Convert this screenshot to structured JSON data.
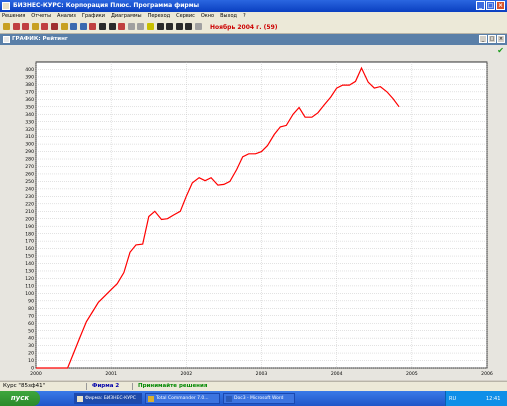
{
  "window": {
    "title": "БИЗНЕС-КУРС: Корпорация Плюс. Программа фирмы"
  },
  "menu": [
    "Решения",
    "Отчеты",
    "Анализ",
    "Графики",
    "Диаграммы",
    "Переход",
    "Сервис",
    "Окно",
    "Выход",
    "?"
  ],
  "toolbar": {
    "period": "Ноябрь 2004 г. (59)",
    "icon_colors": [
      "#c8a020",
      "#c04040",
      "#c04040",
      "#c8a020",
      "#c04040",
      "#a03030",
      "#c8a020",
      "#3a6ab0",
      "#3a6ab0",
      "#c04040",
      "#2a2a2a",
      "#2a2a2a",
      "#c04040",
      "#a0a0a0",
      "#a0a0a0",
      "#c8c000",
      "#2a2a2a",
      "#2a2a2a",
      "#2a2a2a",
      "#2a2a2a",
      "#a0a0a0"
    ]
  },
  "document": {
    "title": "ГРАФИК: Рейтинг"
  },
  "chart_data": {
    "type": "line",
    "x_ticks": [
      "2000",
      "2001",
      "2002",
      "2003",
      "2004",
      "2005",
      "2006"
    ],
    "y_ticks": [
      0,
      10,
      20,
      30,
      40,
      50,
      60,
      70,
      80,
      90,
      100,
      110,
      120,
      130,
      140,
      150,
      160,
      170,
      180,
      190,
      200,
      210,
      220,
      230,
      240,
      250,
      260,
      270,
      280,
      290,
      300,
      310,
      320,
      330,
      340,
      350,
      360,
      370,
      380,
      390,
      400
    ],
    "xlim": [
      2000,
      2006
    ],
    "ylim": [
      0,
      410
    ],
    "grid": true,
    "line_color": "#ff0000",
    "series": [
      {
        "x": [
          2000.42,
          2000.5,
          2000.58,
          2000.67,
          2000.75,
          2000.83,
          2000.92,
          2001.0,
          2001.08,
          2001.17,
          2001.25,
          2001.33,
          2001.42,
          2001.5,
          2001.58,
          2001.67,
          2001.75,
          2001.83,
          2001.92,
          2002.0,
          2002.08,
          2002.17,
          2002.25,
          2002.33,
          2002.42,
          2002.5,
          2002.58,
          2002.67,
          2002.75,
          2002.83,
          2002.92,
          2003.0,
          2003.08,
          2003.17,
          2003.25,
          2003.33,
          2003.42,
          2003.5,
          2003.58,
          2003.67,
          2003.75,
          2003.83,
          2003.92,
          2004.0,
          2004.08,
          2004.17,
          2004.25,
          2004.33,
          2004.42,
          2004.5,
          2004.58,
          2004.67,
          2004.75,
          2004.83
        ],
        "y": [
          0,
          20,
          40,
          62,
          75,
          88,
          97,
          105,
          113,
          128,
          155,
          165,
          166,
          203,
          210,
          199,
          200,
          205,
          210,
          230,
          248,
          255,
          251,
          255,
          245,
          246,
          250,
          266,
          283,
          287,
          287,
          290,
          298,
          313,
          323,
          325,
          340,
          349,
          336,
          336,
          342,
          352,
          363,
          375,
          379,
          379,
          384,
          402,
          383,
          375,
          377,
          370,
          361,
          350
        ]
      }
    ]
  },
  "status": {
    "course": "Курс \"85зф41\"",
    "firm": "Фирма 2",
    "decisions": "Принимайте решения"
  },
  "taskbar": {
    "start": "пуск",
    "tasks": [
      "Фирма: БИЗНЕС-КУРС",
      "Total Commander 7.0...",
      "Doc3 - Microsoft Word"
    ],
    "tray_lang": "RU",
    "clock": "12:41"
  }
}
